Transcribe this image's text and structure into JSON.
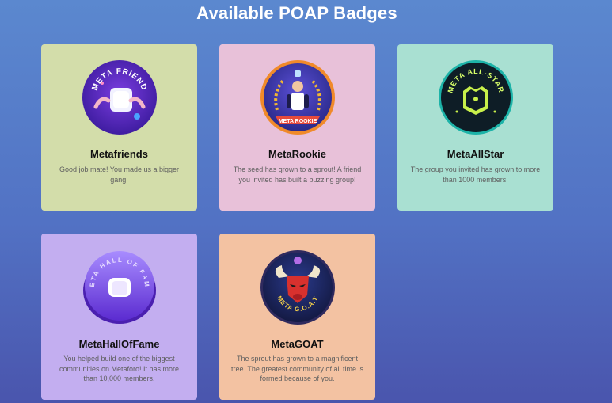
{
  "page": {
    "title": "Available POAP Badges"
  },
  "badges": [
    {
      "name": "Metafriends",
      "description": "Good job mate! You made us a bigger gang.",
      "badge_text": "META FRIEND",
      "icon": "meta-friend-badge-icon",
      "card_color": "#d3ddaa"
    },
    {
      "name": "MetaRookie",
      "description": "The seed has grown to a sprout! A friend you invited has built a buzzing group!",
      "badge_text": "META ROOKIE",
      "icon": "meta-rookie-badge-icon",
      "card_color": "#e8c1d9"
    },
    {
      "name": "MetaAllStar",
      "description": "The group you invited has grown to more than 1000 members!",
      "badge_text": "META ALL-STAR",
      "icon": "meta-all-star-badge-icon",
      "card_color": "#a9e0d2"
    },
    {
      "name": "MetaHallOfFame",
      "description": "You helped build one of the biggest communities on Metaforo! It has more than 10,000 members.",
      "badge_text": "META HALL OF FAME",
      "icon": "meta-hall-of-fame-badge-icon",
      "card_color": "#c3aef0"
    },
    {
      "name": "MetaGOAT",
      "description": "The sprout has grown to a magnificent tree. The greatest community of all time is formed because of you.",
      "badge_text": "META G.O.A.T",
      "icon": "meta-goat-badge-icon",
      "card_color": "#f3c2a2"
    }
  ]
}
